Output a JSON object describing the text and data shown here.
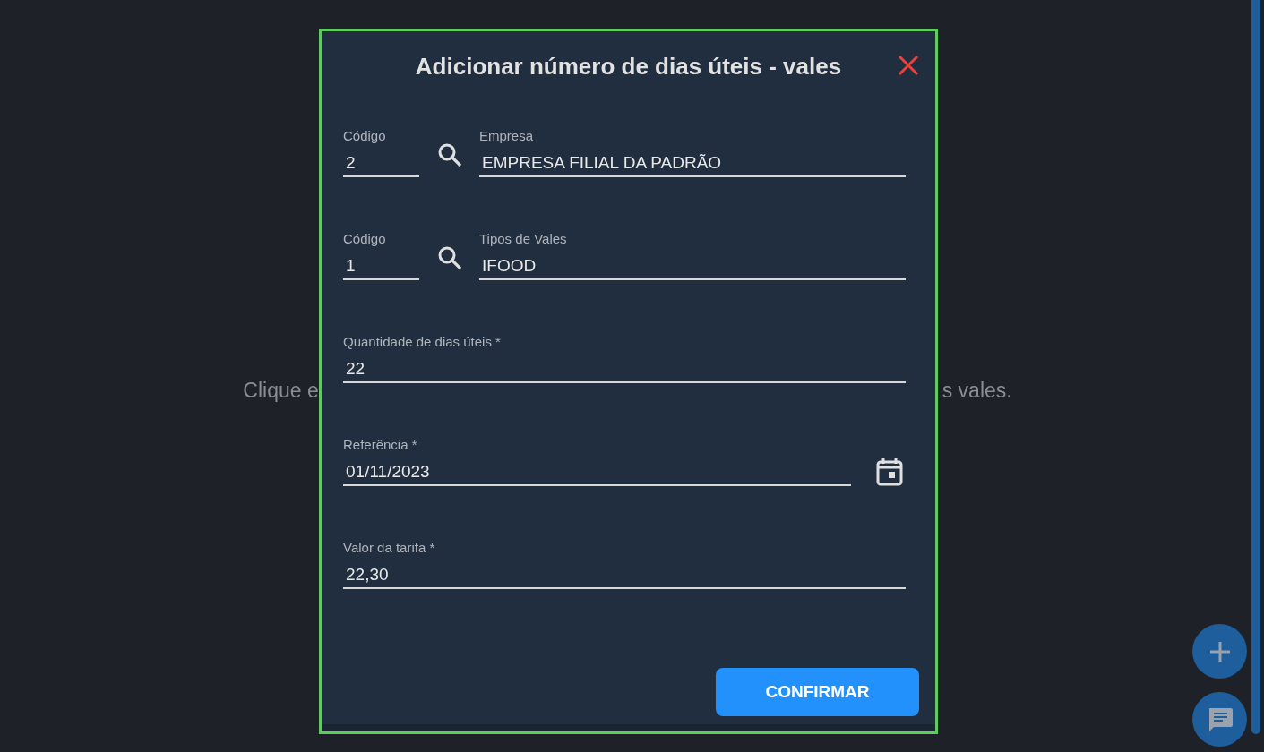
{
  "background_message": {
    "left_part": "Clique e",
    "right_part": "s vales."
  },
  "dialog": {
    "title": "Adicionar número de dias úteis - vales",
    "fields": [
      {
        "kind": "lookup",
        "code_label": "Código",
        "code_value": "2",
        "label": "Empresa",
        "value": "EMPRESA FILIAL DA PADRÃO"
      },
      {
        "kind": "lookup",
        "code_label": "Código",
        "code_value": "1",
        "label": "Tipos de Vales",
        "value": "IFOOD"
      },
      {
        "kind": "text",
        "label": "Quantidade de dias úteis *",
        "value": "22"
      },
      {
        "kind": "date",
        "label": "Referência *",
        "value": "01/11/2023"
      },
      {
        "kind": "text",
        "label": "Valor da tarifa *",
        "value": "22,30"
      }
    ],
    "confirm_button": "CONFIRMAR"
  }
}
